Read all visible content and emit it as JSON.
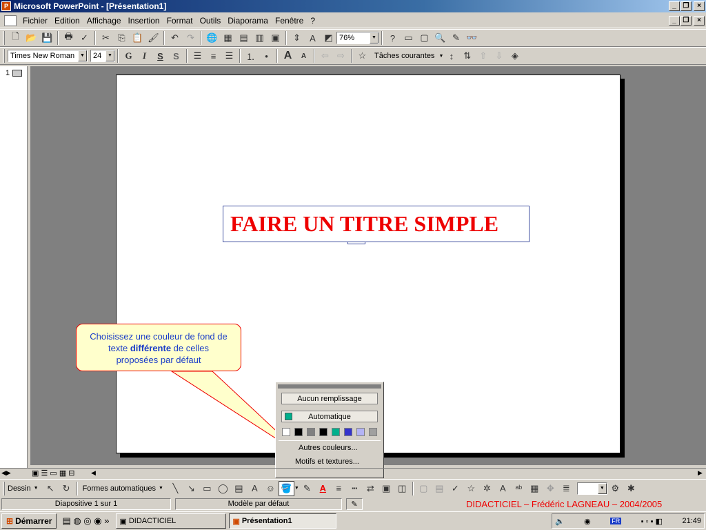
{
  "window": {
    "title": "Microsoft PowerPoint - [Présentation1]"
  },
  "menu": [
    "Fichier",
    "Edition",
    "Affichage",
    "Insertion",
    "Format",
    "Outils",
    "Diaporama",
    "Fenêtre",
    "?"
  ],
  "toolbar": {
    "zoom": "76%"
  },
  "formatting": {
    "font": "Times New Roman",
    "size": "24",
    "bold": "G",
    "italic": "I",
    "underline": "S",
    "shadow": "S",
    "tasks": "Tâches courantes"
  },
  "outline": {
    "slide_number": "1"
  },
  "slide": {
    "title": "FAIRE UN TITRE SIMPLE"
  },
  "callout": {
    "text_before": "Choisissez une couleur de fond de texte ",
    "text_bold": "différente",
    "text_after": " de celles proposées par défaut"
  },
  "fill_menu": {
    "no_fill": "Aucun remplissage",
    "automatic": "Automatique",
    "swatches": [
      "#ffffff",
      "#000000",
      "#808080",
      "#000000",
      "#00b08c",
      "#3333cc",
      "#b3b3f5",
      "#a0a0a0"
    ],
    "more_colors": "Autres couleurs...",
    "patterns": "Motifs et textures..."
  },
  "drawing": {
    "draw": "Dessin",
    "autoshapes": "Formes automatiques"
  },
  "status": {
    "slide": "Diapositive 1 sur 1",
    "template": "Modèle par défaut",
    "credit": "DIDACTICIEL – Frédéric LAGNEAU – 2004/2005"
  },
  "taskbar": {
    "start": "Démarrer",
    "tasks": [
      "DIDACTICIEL",
      "Présentation1"
    ],
    "clock": "21:49",
    "lang": "FR"
  }
}
